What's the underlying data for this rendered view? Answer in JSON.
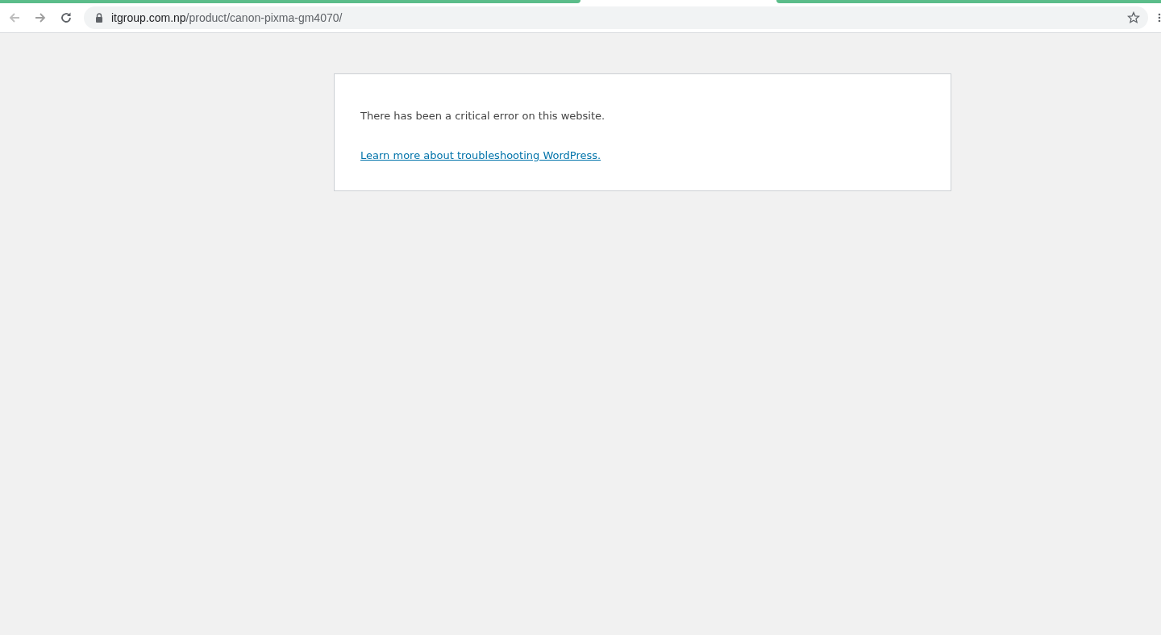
{
  "address_bar": {
    "host": "itgroup.com.np",
    "path": "/product/canon-pixma-gm4070/"
  },
  "error_box": {
    "message": "There has been a critical error on this website.",
    "link": "Learn more about troubleshooting WordPress."
  }
}
